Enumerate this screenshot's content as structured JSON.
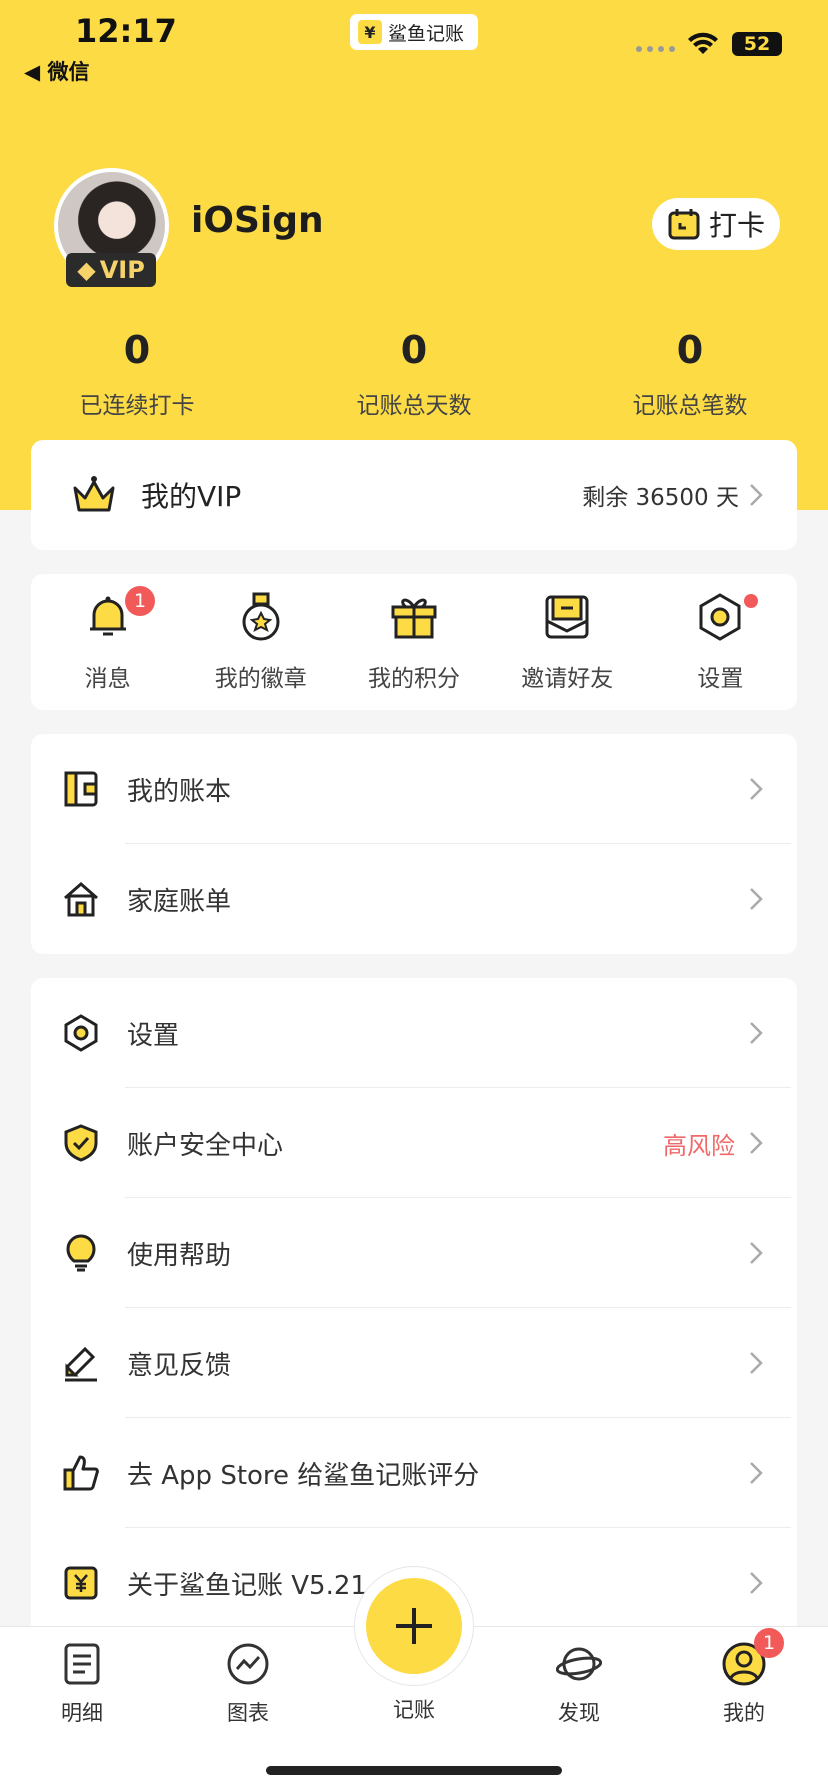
{
  "status_bar": {
    "time": "12:17",
    "back_app": "◀ 微信",
    "app_name": "鲨鱼记账",
    "app_logo": "¥",
    "battery": "52"
  },
  "profile": {
    "username": "iOSign",
    "vip_badge": "VIP",
    "checkin_label": "打卡"
  },
  "stats": [
    {
      "value": "0",
      "label": "已连续打卡"
    },
    {
      "value": "0",
      "label": "记账总天数"
    },
    {
      "value": "0",
      "label": "记账总笔数"
    }
  ],
  "vip_card": {
    "title": "我的VIP",
    "remaining": "剩余 36500 天"
  },
  "quick_actions": [
    {
      "label": "消息",
      "badge": "1",
      "icon": "bell-icon"
    },
    {
      "label": "我的徽章",
      "icon": "medal-icon"
    },
    {
      "label": "我的积分",
      "icon": "gift-icon"
    },
    {
      "label": "邀请好友",
      "icon": "envelope-icon"
    },
    {
      "label": "设置",
      "icon": "hexagon-settings-icon"
    }
  ],
  "book_menu": [
    {
      "label": "我的账本",
      "icon": "ledger-icon"
    },
    {
      "label": "家庭账单",
      "icon": "house-icon"
    }
  ],
  "settings_menu": [
    {
      "label": "设置",
      "icon": "hexagon-settings-icon"
    },
    {
      "label": "账户安全中心",
      "extra": "高风险",
      "icon": "shield-icon"
    },
    {
      "label": "使用帮助",
      "icon": "lightbulb-icon"
    },
    {
      "label": "意见反馈",
      "icon": "pencil-icon"
    },
    {
      "label": "去 App Store 给鲨鱼记账评分",
      "icon": "thumbs-up-icon"
    },
    {
      "label": "关于鲨鱼记账 V5.21",
      "icon": "app-logo-icon"
    }
  ],
  "tabbar": {
    "tabs": [
      {
        "label": "明细",
        "icon": "list-doc-icon"
      },
      {
        "label": "图表",
        "icon": "chart-icon"
      },
      {
        "label": "记账",
        "icon": "plus-icon"
      },
      {
        "label": "发现",
        "icon": "planet-icon"
      },
      {
        "label": "我的",
        "icon": "profile-icon",
        "badge": "1"
      }
    ]
  },
  "colors": {
    "brand_yellow": "#fcdb45",
    "alert_red": "#f25a5a",
    "risk_text": "#f06a6a"
  }
}
